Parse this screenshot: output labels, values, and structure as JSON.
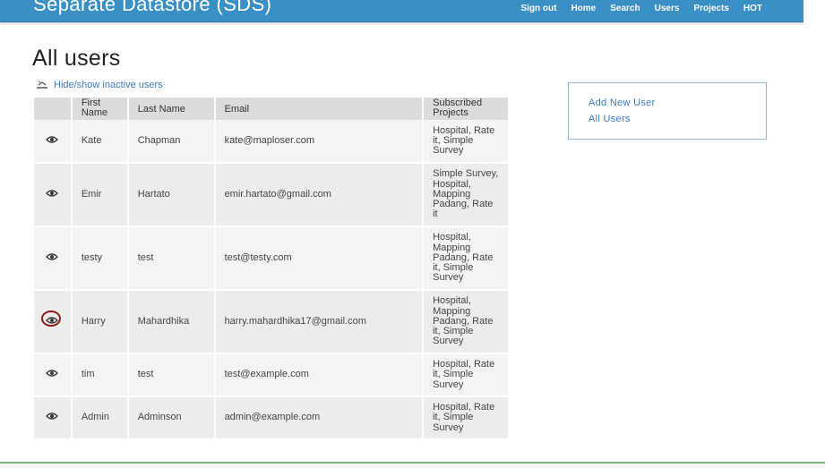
{
  "app": {
    "title": "Separate Datastore (SDS)",
    "nav": [
      "Sign out",
      "Home",
      "Search",
      "Users",
      "Projects",
      "HOT"
    ]
  },
  "page": {
    "title": "All users",
    "toggle_link": "Hide/show inactive users"
  },
  "table": {
    "headers": {
      "view": "",
      "first_name": "First Name",
      "last_name": "Last Name",
      "email": "Email",
      "projects": "Subscribed Projects"
    },
    "rows": [
      {
        "first": "Kate",
        "last": "Chapman",
        "email": "kate@maploser.com",
        "projects": "Hospital, Rate it, Simple Survey"
      },
      {
        "first": "Emir",
        "last": "Hartato",
        "email": "emir.hartato@gmail.com",
        "projects": "Simple Survey, Hospital, Mapping Padang, Rate it"
      },
      {
        "first": "testy",
        "last": "test",
        "email": "test@testy.com",
        "projects": "Hospital, Mapping Padang, Rate it, Simple Survey"
      },
      {
        "first": "Harry",
        "last": "Mahardhika",
        "email": "harry.mahardhika17@gmail.com",
        "projects": "Hospital, Mapping Padang, Rate it, Simple Survey"
      },
      {
        "first": "tim",
        "last": "test",
        "email": "test@example.com",
        "projects": "Hospital, Rate it, Simple Survey"
      },
      {
        "first": "Admin",
        "last": "Adminson",
        "email": "admin@example.com",
        "projects": "Hospital, Rate it, Simple Survey"
      }
    ]
  },
  "sidebar": {
    "links": [
      "Add New User",
      "All Users"
    ]
  },
  "icons": {
    "view": "eye-icon",
    "toggle": "toggle-icon",
    "highlight_color": "#8b1a1a",
    "accent": "#3a8fc4"
  }
}
